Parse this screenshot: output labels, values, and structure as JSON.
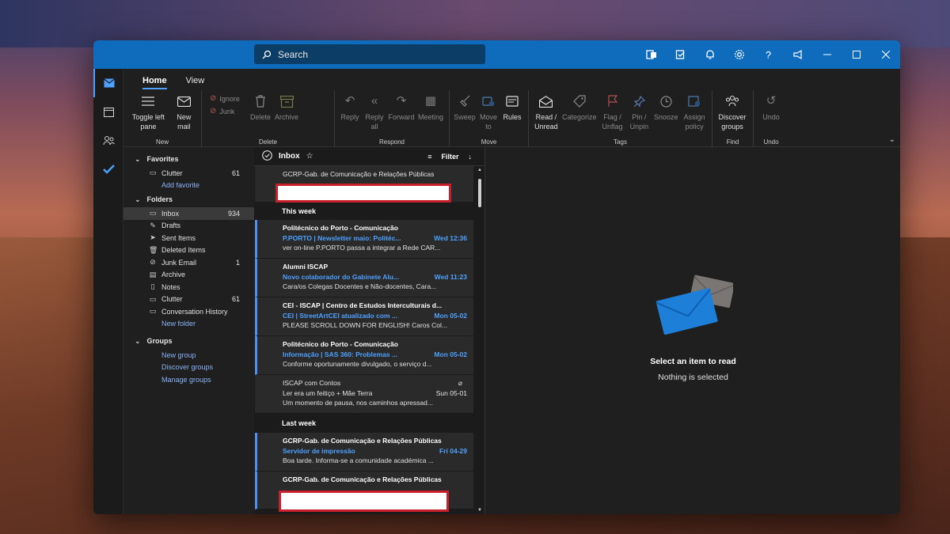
{
  "search": {
    "placeholder": "Search"
  },
  "ribbon": {
    "tabs": [
      "Home",
      "View"
    ],
    "new": {
      "toggle": "Toggle left pane",
      "toggle_l1": "Toggle left",
      "toggle_l2": "pane",
      "new_mail_l1": "New",
      "new_mail_l2": "mail",
      "label": "New"
    },
    "delete": {
      "ignore": "Ignore",
      "junk": "Junk",
      "delete": "Delete",
      "archive": "Archive",
      "label": "Delete"
    },
    "respond": {
      "reply": "Reply",
      "reply_all_l1": "Reply",
      "reply_all_l2": "all",
      "forward": "Forward",
      "meeting": "Meeting",
      "label": "Respond"
    },
    "move": {
      "sweep": "Sweep",
      "move_l1": "Move",
      "move_l2": "to",
      "rules": "Rules",
      "label": "Move"
    },
    "tags": {
      "read_l1": "Read /",
      "read_l2": "Unread",
      "categorize": "Categorize",
      "flag_l1": "Flag /",
      "flag_l2": "Unflag",
      "pin_l1": "Pin /",
      "pin_l2": "Unpin",
      "snooze": "Snooze",
      "assign_l1": "Assign",
      "assign_l2": "policy",
      "label": "Tags"
    },
    "find": {
      "discover_l1": "Discover",
      "discover_l2": "groups",
      "label": "Find"
    },
    "undo": {
      "undo": "Undo",
      "label": "Undo"
    }
  },
  "folders": {
    "favorites": "Favorites",
    "fav_items": [
      {
        "name": "Clutter",
        "count": "61",
        "icon": "folder-icon"
      }
    ],
    "add_favorite": "Add favorite",
    "folders_title": "Folders",
    "items": [
      {
        "name": "Inbox",
        "count": "934",
        "icon": "inbox-icon"
      },
      {
        "name": "Drafts",
        "count": "",
        "icon": "pencil-icon"
      },
      {
        "name": "Sent Items",
        "count": "",
        "icon": "send-icon"
      },
      {
        "name": "Deleted Items",
        "count": "",
        "icon": "trash-icon"
      },
      {
        "name": "Junk Email",
        "count": "1",
        "icon": "junk-icon"
      },
      {
        "name": "Archive",
        "count": "",
        "icon": "archive-icon"
      },
      {
        "name": "Notes",
        "count": "",
        "icon": "notes-icon"
      },
      {
        "name": "Clutter",
        "count": "61",
        "icon": "folder-icon"
      },
      {
        "name": "Conversation History",
        "count": "",
        "icon": "folder-icon"
      }
    ],
    "new_folder": "New folder",
    "groups_title": "Groups",
    "group_links": [
      "New group",
      "Discover groups",
      "Manage groups"
    ]
  },
  "list": {
    "title": "Inbox",
    "filter": "Filter",
    "pinned": {
      "from": "GCRP-Gab. de Comunicação e Relações Públicas"
    },
    "this_week": "This week",
    "last_week": "Last week",
    "messages_this_week": [
      {
        "from": "Politécnico do Porto - Comunicação",
        "subject": "P.PORTO | Newsletter maio: Politéc...",
        "date": "Wed 12:36",
        "preview": "ver on-line P.PORTO passa a integrar a Rede CAR...",
        "unread": true
      },
      {
        "from": "Alumni ISCAP",
        "subject": "Novo colaborador do Gabinete Alu...",
        "date": "Wed 11:23",
        "preview": "Cara/os Colegas Docentes e Não-docentes, Cara...",
        "unread": true
      },
      {
        "from": "CEI - ISCAP | Centro de Estudos Interculturais d...",
        "subject": "CEI | StreetArtCEI atualizado com ...",
        "date": "Mon 05-02",
        "preview": "PLEASE SCROLL DOWN FOR ENGLISH! Caros Col...",
        "unread": true
      },
      {
        "from": "Politécnico do Porto - Comunicação",
        "subject": "Informação | SAS 360: Problemas ...",
        "date": "Mon 05-02",
        "preview": "Conforme oportunamente divulgado, o serviço d...",
        "unread": true
      },
      {
        "from": "ISCAP com Contos",
        "subject": "Ler era um feitiço + Mãe Terra",
        "date": "Sun 05-01",
        "preview": "Um momento de pausa, nos caminhos apressad...",
        "unread": false
      }
    ],
    "messages_last_week": [
      {
        "from": "GCRP-Gab. de Comunicação e Relações Públicas",
        "subject": "Servidor de impressão",
        "date": "Fri 04-29",
        "preview": "Boa tarde. Informa-se a comunidade académica ...",
        "unread": true
      },
      {
        "from": "GCRP-Gab. de Comunicação e Relações Públicas",
        "subject": "",
        "date": "",
        "preview": "",
        "unread": true
      }
    ]
  },
  "reading": {
    "title": "Select an item to read",
    "subtitle": "Nothing is selected"
  },
  "colors": {
    "accent": "#0f6cbd",
    "link": "#8ab4f8",
    "unread": "#4ea1ff",
    "redact_border": "#c8202a"
  }
}
